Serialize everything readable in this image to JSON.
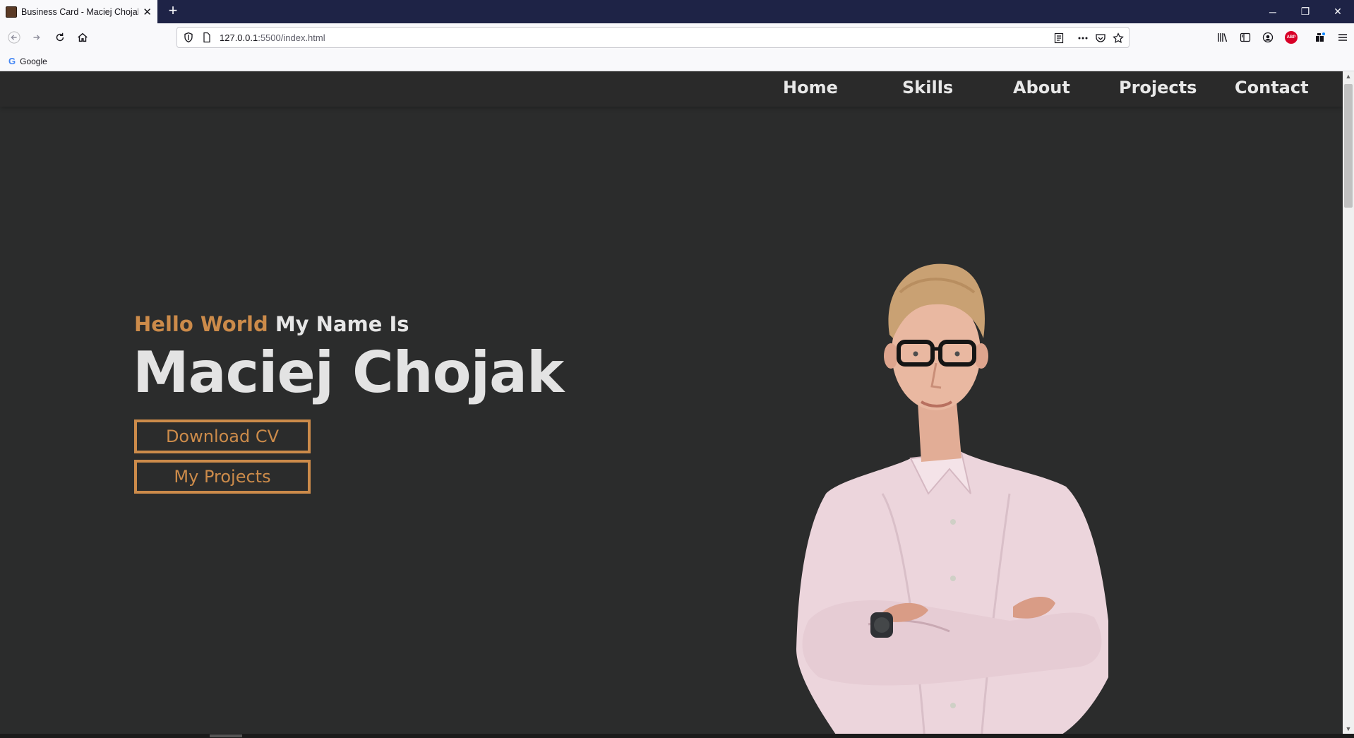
{
  "browser": {
    "tab": {
      "title": "Business Card - Maciej Chojak",
      "close": "✕"
    },
    "new_tab": "+",
    "window_controls": {
      "minimize": "─",
      "restore": "❐",
      "close": "✕"
    },
    "url": {
      "host": "127.0.0.1",
      "rest": ":5500/index.html"
    },
    "bookmarks": [
      {
        "label": "Google"
      }
    ]
  },
  "site": {
    "nav": [
      "Home",
      "Skills",
      "About",
      "Projects",
      "Contact"
    ],
    "hero": {
      "hello_accent": "Hello World",
      "hello_rest": "My Name Is",
      "name": "Maciej Chojak",
      "buttons": [
        "Download CV",
        "My Projects"
      ]
    }
  },
  "colors": {
    "page_bg": "#2b2c2c",
    "nav_bg": "#2a2a2a",
    "accent": "#cc8b4a",
    "text": "#e6e6e6",
    "tabbar": "#1e2346"
  },
  "icons": [
    "back-icon",
    "forward-icon",
    "reload-icon",
    "home-icon",
    "shield-icon",
    "page-icon",
    "reader-view-icon",
    "more-icon",
    "pocket-icon",
    "bookmark-star-icon",
    "library-icon",
    "sidebar-icon",
    "account-icon",
    "adblock-icon",
    "extensions-icon",
    "menu-icon",
    "google-icon"
  ]
}
